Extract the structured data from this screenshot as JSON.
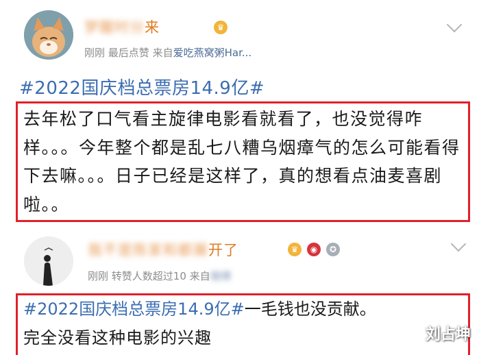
{
  "posts": [
    {
      "user_name_visible": "来",
      "meta": {
        "time": "刚刚",
        "extra": "最后点赞",
        "source_prefix": "来自",
        "source": "爱吃燕窝粥Har..."
      },
      "hashtag": "#2022国庆档总票房14.9亿#",
      "body": "去年松了口气看主旋律电影看就看了，也没觉得咋样。。。今年整个都是乱七八糟乌烟瘴气的怎么可能看得下去嘛。。。日子已经是这样了，真的想看点油麦喜剧啦。。"
    },
    {
      "user_name_visible": "开了",
      "meta": {
        "time": "刚刚",
        "extra": "转赞人数超过10",
        "source_prefix": "来自"
      },
      "hashtag": "#2022国庆档总票房14.9亿#",
      "text_after_tag": "一毛钱也没贡献。",
      "line2": "完全没看这种电影的兴趣"
    }
  ],
  "watermark": "刘占坤",
  "colors": {
    "accent_blue": "#3b6db1",
    "highlight_red": "#e0202a",
    "username_orange": "#e07a1f"
  }
}
